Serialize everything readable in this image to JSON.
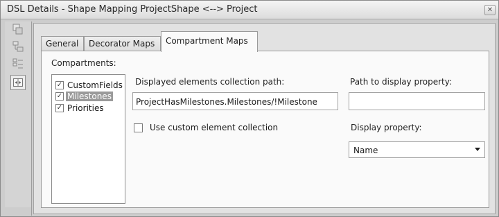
{
  "window": {
    "title": "DSL Details - Shape Mapping ProjectShape <--> Project",
    "close_glyph": "✕"
  },
  "toolstrip": {
    "tools": [
      {
        "icon": "shape-mapping-icon"
      },
      {
        "icon": "element-mapping-icon"
      },
      {
        "icon": "properties-grid-icon"
      },
      {
        "icon": "compartment-icon",
        "selected": true
      }
    ]
  },
  "tabs": [
    {
      "label": "General"
    },
    {
      "label": "Decorator Maps"
    },
    {
      "label": "Compartment Maps",
      "active": true
    }
  ],
  "compartments": {
    "label": "Compartments:",
    "items": [
      {
        "label": "CustomFields",
        "checked": true
      },
      {
        "label": "Milestones",
        "checked": true,
        "selected": true
      },
      {
        "label": "Priorities",
        "checked": true
      }
    ]
  },
  "collection_path": {
    "label": "Displayed elements collection path:",
    "value": "ProjectHasMilestones.Milestones/!Milestone"
  },
  "use_custom": {
    "label": "Use custom element collection",
    "checked": false
  },
  "path_to_display": {
    "label": "Path to display property:",
    "value": ""
  },
  "display_property": {
    "label": "Display property:",
    "value": "Name"
  },
  "check_glyph": "✓"
}
